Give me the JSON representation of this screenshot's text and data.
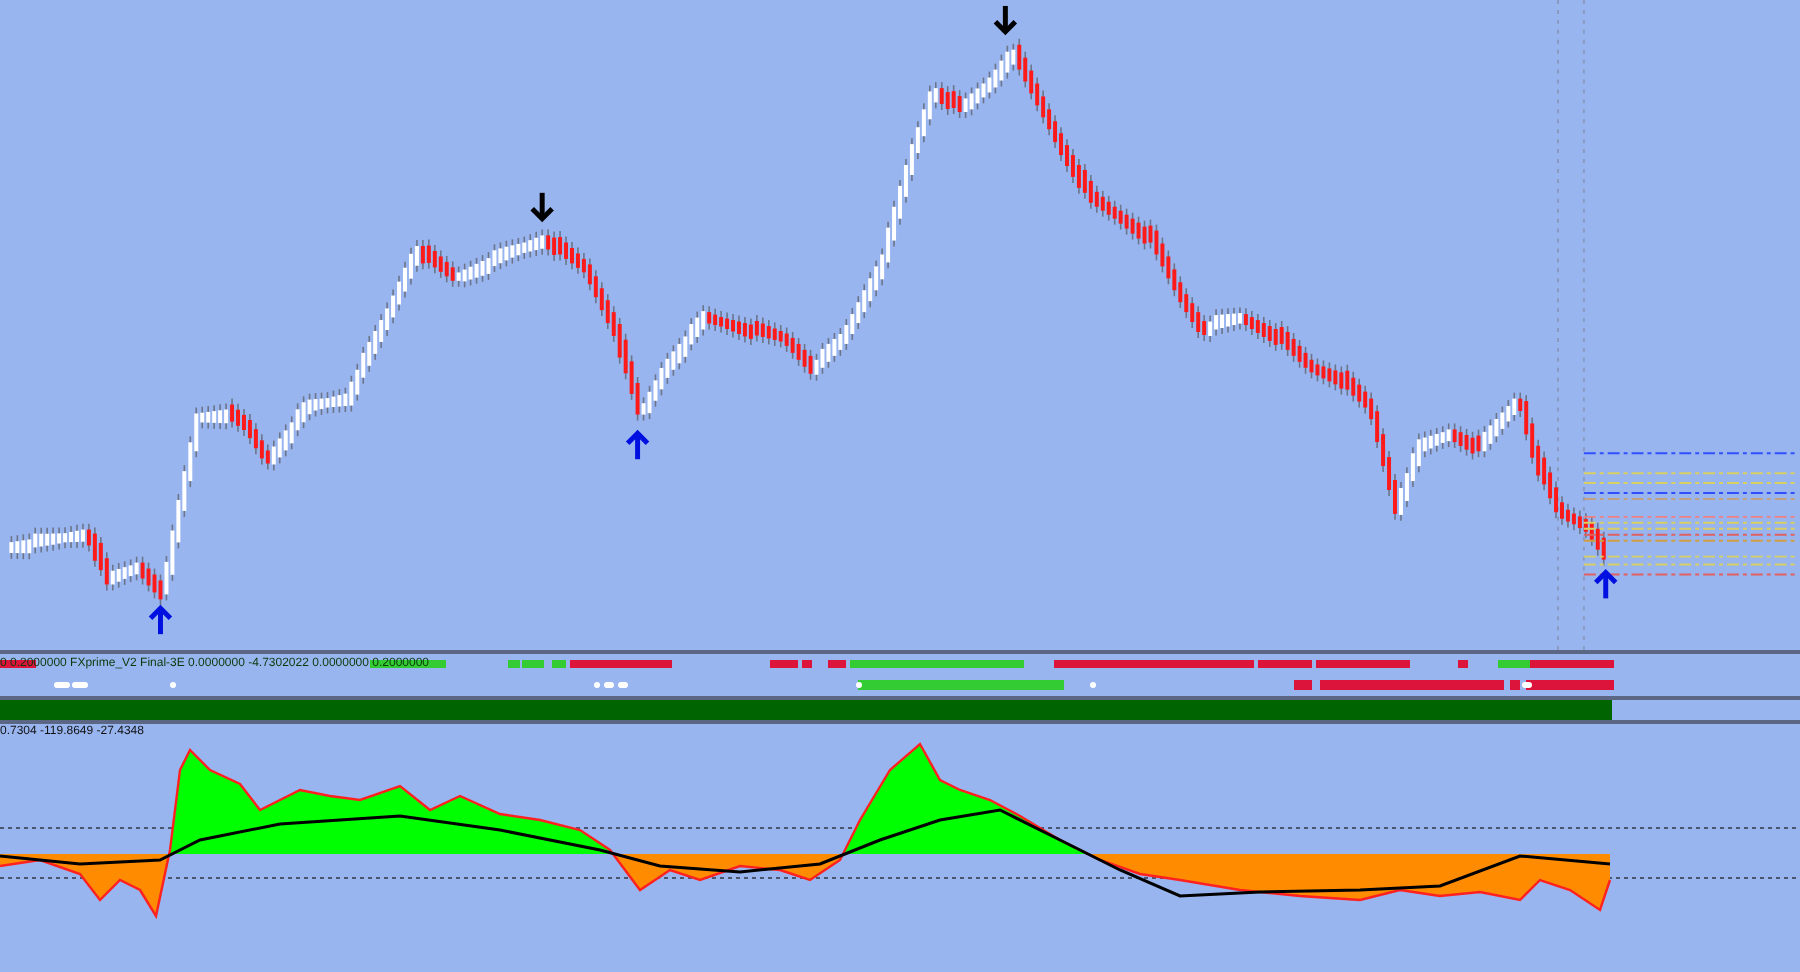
{
  "signal_panel": {
    "label": "0 0.2000000 FXprime_V2 Final-3E 0.0000000 -4.7302022 0.0000000 0.2000000"
  },
  "oscillator_panel": {
    "label": "0.7304 -119.8649 -27.4348"
  }
}
